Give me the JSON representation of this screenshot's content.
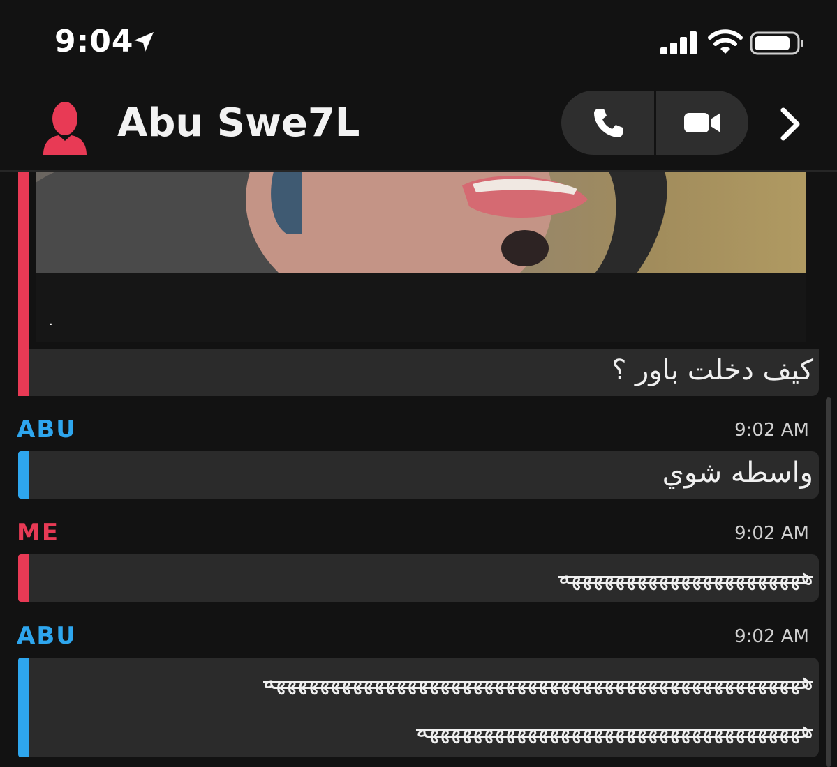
{
  "status_bar": {
    "time": "9:04",
    "icons": [
      "location-arrow-icon",
      "cellular-signal-icon",
      "wifi-icon",
      "battery-icon"
    ]
  },
  "header": {
    "contact_name": "Abu Swe7L",
    "icons": [
      "avatar-icon",
      "phone-icon",
      "video-camera-icon",
      "chevron-right-icon"
    ]
  },
  "messages": [
    {
      "sender": "",
      "time": "",
      "text": "كيف دخلت باور ؟",
      "color": "#e83a55",
      "has_media": true,
      "media_caption": "."
    },
    {
      "sender": "ABU",
      "time": "9:02 AM",
      "text": "واسطه شوي",
      "color": "#2ea6ee"
    },
    {
      "sender": "ME",
      "time": "9:02 AM",
      "text": "ههههههههههههههههههههههه",
      "color": "#e83a55"
    },
    {
      "sender": "ABU",
      "time": "9:02 AM",
      "text_line1": "هههههههههههههههههههههههههههههههههههههههههههههههههه",
      "text_line2": "هههههههههههههههههههههههههههههههههههه",
      "color": "#2ea6ee"
    }
  ],
  "colors": {
    "background": "#121212",
    "bubble": "#2b2b2b",
    "me_accent": "#e83a55",
    "friend_accent": "#2ea6ee"
  }
}
